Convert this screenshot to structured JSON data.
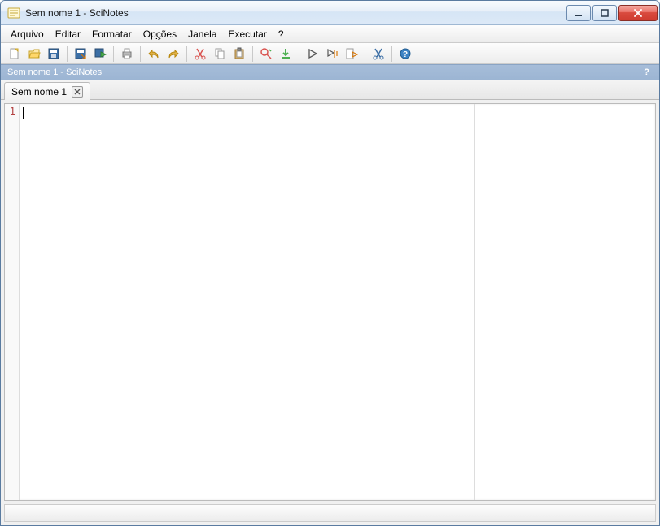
{
  "window": {
    "title": "Sem nome 1 - SciNotes"
  },
  "menu": {
    "arquivo": "Arquivo",
    "editar": "Editar",
    "formatar": "Formatar",
    "opcoes": "Opções",
    "janela": "Janela",
    "executar": "Executar",
    "ajuda": "?"
  },
  "subheader": {
    "title": "Sem nome 1 - SciNotes",
    "help": "?"
  },
  "tab": {
    "label": "Sem nome 1"
  },
  "editor": {
    "line1": "1"
  }
}
